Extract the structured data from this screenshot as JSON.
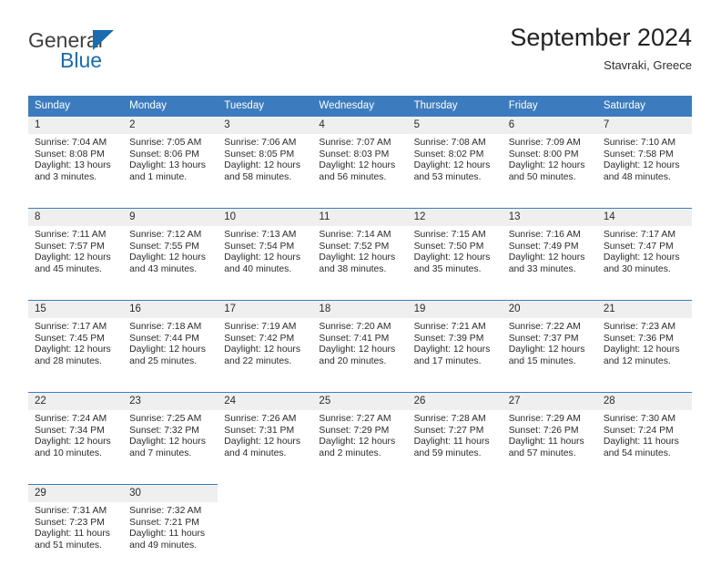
{
  "brand": {
    "name_part1": "General",
    "name_part2": "Blue",
    "accent_color": "#1b6cb0"
  },
  "header": {
    "title": "September 2024",
    "location": "Stavraki, Greece",
    "header_bg_color": "#3c7cbe",
    "daynum_bg_color": "#efefef"
  },
  "weekdays": [
    "Sunday",
    "Monday",
    "Tuesday",
    "Wednesday",
    "Thursday",
    "Friday",
    "Saturday"
  ],
  "weeks": [
    [
      {
        "day": "1",
        "sunrise": "Sunrise: 7:04 AM",
        "sunset": "Sunset: 8:08 PM",
        "daylight": "Daylight: 13 hours and 3 minutes."
      },
      {
        "day": "2",
        "sunrise": "Sunrise: 7:05 AM",
        "sunset": "Sunset: 8:06 PM",
        "daylight": "Daylight: 13 hours and 1 minute."
      },
      {
        "day": "3",
        "sunrise": "Sunrise: 7:06 AM",
        "sunset": "Sunset: 8:05 PM",
        "daylight": "Daylight: 12 hours and 58 minutes."
      },
      {
        "day": "4",
        "sunrise": "Sunrise: 7:07 AM",
        "sunset": "Sunset: 8:03 PM",
        "daylight": "Daylight: 12 hours and 56 minutes."
      },
      {
        "day": "5",
        "sunrise": "Sunrise: 7:08 AM",
        "sunset": "Sunset: 8:02 PM",
        "daylight": "Daylight: 12 hours and 53 minutes."
      },
      {
        "day": "6",
        "sunrise": "Sunrise: 7:09 AM",
        "sunset": "Sunset: 8:00 PM",
        "daylight": "Daylight: 12 hours and 50 minutes."
      },
      {
        "day": "7",
        "sunrise": "Sunrise: 7:10 AM",
        "sunset": "Sunset: 7:58 PM",
        "daylight": "Daylight: 12 hours and 48 minutes."
      }
    ],
    [
      {
        "day": "8",
        "sunrise": "Sunrise: 7:11 AM",
        "sunset": "Sunset: 7:57 PM",
        "daylight": "Daylight: 12 hours and 45 minutes."
      },
      {
        "day": "9",
        "sunrise": "Sunrise: 7:12 AM",
        "sunset": "Sunset: 7:55 PM",
        "daylight": "Daylight: 12 hours and 43 minutes."
      },
      {
        "day": "10",
        "sunrise": "Sunrise: 7:13 AM",
        "sunset": "Sunset: 7:54 PM",
        "daylight": "Daylight: 12 hours and 40 minutes."
      },
      {
        "day": "11",
        "sunrise": "Sunrise: 7:14 AM",
        "sunset": "Sunset: 7:52 PM",
        "daylight": "Daylight: 12 hours and 38 minutes."
      },
      {
        "day": "12",
        "sunrise": "Sunrise: 7:15 AM",
        "sunset": "Sunset: 7:50 PM",
        "daylight": "Daylight: 12 hours and 35 minutes."
      },
      {
        "day": "13",
        "sunrise": "Sunrise: 7:16 AM",
        "sunset": "Sunset: 7:49 PM",
        "daylight": "Daylight: 12 hours and 33 minutes."
      },
      {
        "day": "14",
        "sunrise": "Sunrise: 7:17 AM",
        "sunset": "Sunset: 7:47 PM",
        "daylight": "Daylight: 12 hours and 30 minutes."
      }
    ],
    [
      {
        "day": "15",
        "sunrise": "Sunrise: 7:17 AM",
        "sunset": "Sunset: 7:45 PM",
        "daylight": "Daylight: 12 hours and 28 minutes."
      },
      {
        "day": "16",
        "sunrise": "Sunrise: 7:18 AM",
        "sunset": "Sunset: 7:44 PM",
        "daylight": "Daylight: 12 hours and 25 minutes."
      },
      {
        "day": "17",
        "sunrise": "Sunrise: 7:19 AM",
        "sunset": "Sunset: 7:42 PM",
        "daylight": "Daylight: 12 hours and 22 minutes."
      },
      {
        "day": "18",
        "sunrise": "Sunrise: 7:20 AM",
        "sunset": "Sunset: 7:41 PM",
        "daylight": "Daylight: 12 hours and 20 minutes."
      },
      {
        "day": "19",
        "sunrise": "Sunrise: 7:21 AM",
        "sunset": "Sunset: 7:39 PM",
        "daylight": "Daylight: 12 hours and 17 minutes."
      },
      {
        "day": "20",
        "sunrise": "Sunrise: 7:22 AM",
        "sunset": "Sunset: 7:37 PM",
        "daylight": "Daylight: 12 hours and 15 minutes."
      },
      {
        "day": "21",
        "sunrise": "Sunrise: 7:23 AM",
        "sunset": "Sunset: 7:36 PM",
        "daylight": "Daylight: 12 hours and 12 minutes."
      }
    ],
    [
      {
        "day": "22",
        "sunrise": "Sunrise: 7:24 AM",
        "sunset": "Sunset: 7:34 PM",
        "daylight": "Daylight: 12 hours and 10 minutes."
      },
      {
        "day": "23",
        "sunrise": "Sunrise: 7:25 AM",
        "sunset": "Sunset: 7:32 PM",
        "daylight": "Daylight: 12 hours and 7 minutes."
      },
      {
        "day": "24",
        "sunrise": "Sunrise: 7:26 AM",
        "sunset": "Sunset: 7:31 PM",
        "daylight": "Daylight: 12 hours and 4 minutes."
      },
      {
        "day": "25",
        "sunrise": "Sunrise: 7:27 AM",
        "sunset": "Sunset: 7:29 PM",
        "daylight": "Daylight: 12 hours and 2 minutes."
      },
      {
        "day": "26",
        "sunrise": "Sunrise: 7:28 AM",
        "sunset": "Sunset: 7:27 PM",
        "daylight": "Daylight: 11 hours and 59 minutes."
      },
      {
        "day": "27",
        "sunrise": "Sunrise: 7:29 AM",
        "sunset": "Sunset: 7:26 PM",
        "daylight": "Daylight: 11 hours and 57 minutes."
      },
      {
        "day": "28",
        "sunrise": "Sunrise: 7:30 AM",
        "sunset": "Sunset: 7:24 PM",
        "daylight": "Daylight: 11 hours and 54 minutes."
      }
    ],
    [
      {
        "day": "29",
        "sunrise": "Sunrise: 7:31 AM",
        "sunset": "Sunset: 7:23 PM",
        "daylight": "Daylight: 11 hours and 51 minutes."
      },
      {
        "day": "30",
        "sunrise": "Sunrise: 7:32 AM",
        "sunset": "Sunset: 7:21 PM",
        "daylight": "Daylight: 11 hours and 49 minutes."
      },
      {
        "day": "",
        "sunrise": "",
        "sunset": "",
        "daylight": ""
      },
      {
        "day": "",
        "sunrise": "",
        "sunset": "",
        "daylight": ""
      },
      {
        "day": "",
        "sunrise": "",
        "sunset": "",
        "daylight": ""
      },
      {
        "day": "",
        "sunrise": "",
        "sunset": "",
        "daylight": ""
      },
      {
        "day": "",
        "sunrise": "",
        "sunset": "",
        "daylight": ""
      }
    ]
  ]
}
